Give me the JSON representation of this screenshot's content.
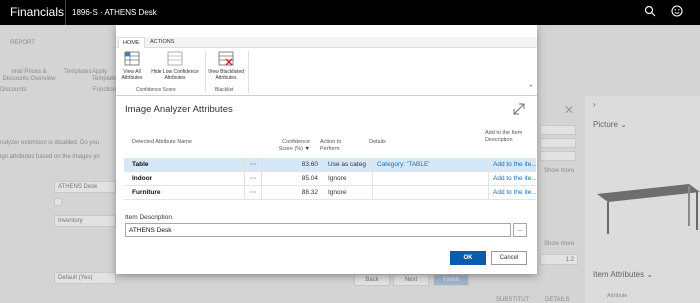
{
  "topbar": {
    "brand": "Financials",
    "document_title": "1896-S · ATHENS Desk",
    "search_icon": "search-icon",
    "smile_icon": "smiley-icon"
  },
  "background": {
    "report_label": "REPORT",
    "ribbon_items": [
      "onal Prices & Discounts Overview",
      "Templates",
      "Apply Template"
    ],
    "group_labels": [
      "Discounts",
      "Function"
    ],
    "banner_line1": "nalyzer extension is disabled. Do you",
    "banner_line2": "ign attributes based on the images yo",
    "field_description": "ATHENS Desk",
    "field_inventory": "Inventory",
    "field_default": "Default (Yes)",
    "show_more_1": "Show more",
    "show_more_2": "Show more",
    "value_12": "1.2",
    "picture_title": "Picture",
    "item_attributes_title": "Item Attributes",
    "attribute_label": "Attribute",
    "wizard_back": "Back",
    "wizard_next": "Next",
    "wizard_finish": "Finish",
    "bottom_links": [
      "SUBSTITUT",
      "DETAILS"
    ]
  },
  "dialog": {
    "tabs": [
      "HOME",
      "ACTIONS"
    ],
    "active_tab": "HOME",
    "ribbon": {
      "view_all": "View All Attributes",
      "hide_low": "Hide Low Confidence Attributes",
      "view_blacklisted": "View Blacklisted Attributes",
      "group_confidence": "Confidence Score",
      "group_blacklist": "Blacklist"
    },
    "title": "Image Analyzer Attributes",
    "columns": {
      "name": "Detected Attribute Name",
      "score": "Confidence Score (%)",
      "action": "Action to Perform",
      "details": "Details",
      "add": "Add to the Item Description"
    },
    "rows": [
      {
        "name": "Table",
        "score": "83.60",
        "action": "Use as categ",
        "details": "Category: 'TABLE'",
        "add": "Add to the ite..."
      },
      {
        "name": "Indoor",
        "score": "85.04",
        "action": "Ignore",
        "details": "",
        "add": "Add to the ite..."
      },
      {
        "name": "Furniture",
        "score": "88.32",
        "action": "Ignore",
        "details": "",
        "add": "Add to the ite..."
      }
    ],
    "item_description_label": "Item Description",
    "item_description_value": "ATHENS Desk",
    "ok_label": "OK",
    "cancel_label": "Cancel"
  }
}
